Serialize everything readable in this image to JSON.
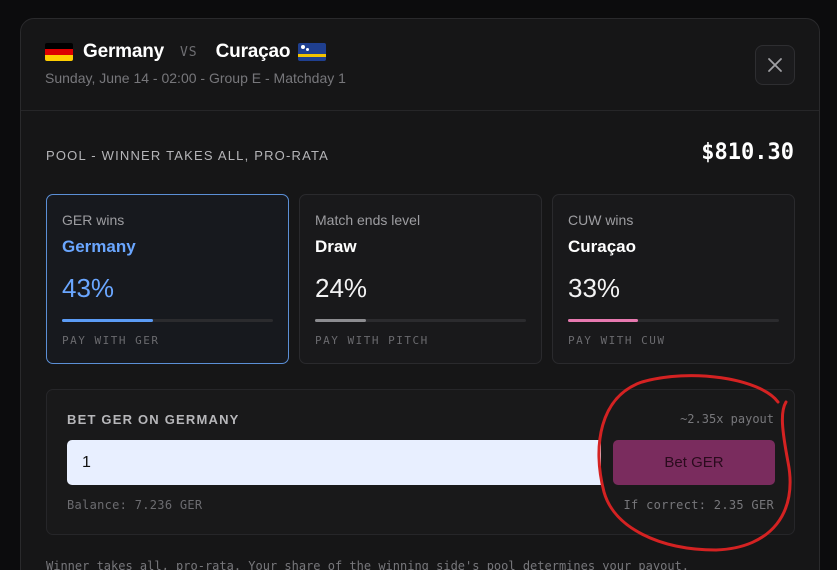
{
  "header": {
    "home_team": "Germany",
    "vs_label": "VS",
    "away_team": "Curaçao",
    "subtitle": "Sunday, June 14 - 02:00 - Group E - Matchday 1",
    "close_icon": "close-icon"
  },
  "pool": {
    "label": "POOL - WINNER TAKES ALL, PRO-RATA",
    "value": "$810.30"
  },
  "outcomes": [
    {
      "code_label": "GER wins",
      "name": "Germany",
      "percent": "43%",
      "share": 0.43,
      "pay_label": "PAY WITH GER",
      "color": "#5b9bf5",
      "selected": true
    },
    {
      "code_label": "Match ends level",
      "name": "Draw",
      "percent": "24%",
      "share": 0.24,
      "pay_label": "PAY WITH PITCH",
      "color": "#8c8c90",
      "selected": false
    },
    {
      "code_label": "CUW wins",
      "name": "Curaçao",
      "percent": "33%",
      "share": 0.33,
      "pay_label": "PAY WITH CUW",
      "color": "#e779b0",
      "selected": false
    }
  ],
  "bet": {
    "title": "BET GER ON GERMANY",
    "payout": "~2.35x payout",
    "amount": "1",
    "button_label": "Bet GER",
    "balance": "Balance: 7.236 GER",
    "if_correct": "If correct: 2.35 GER"
  },
  "footer": {
    "note": "Winner takes all, pro-rata. Your share of the winning side's pool determines your payout."
  },
  "colors": {
    "accent_blue": "#5b9bf5",
    "bet_button": "#7a2c5e",
    "annotation_red": "#d42222"
  }
}
